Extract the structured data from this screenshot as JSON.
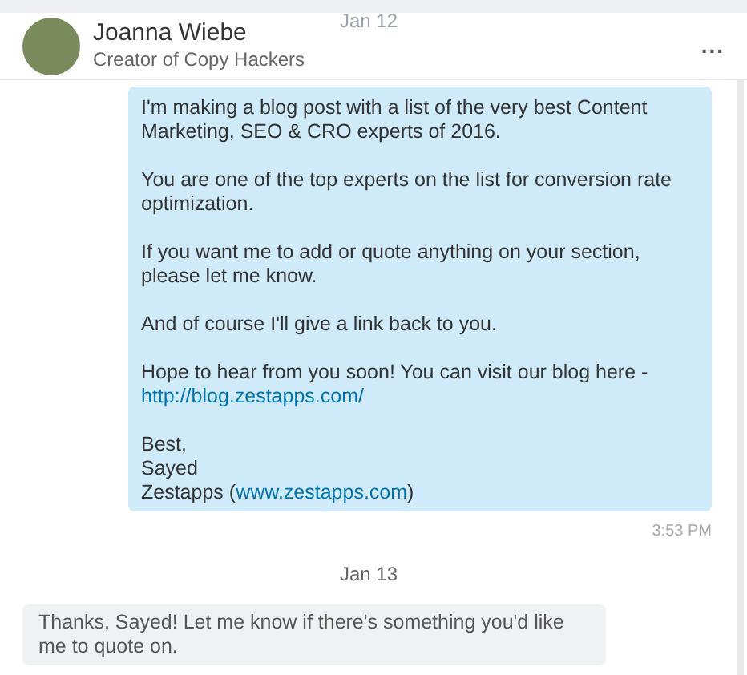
{
  "header": {
    "date_behind": "Jan 12",
    "name": "Joanna Wiebe",
    "subtitle": "Creator of Copy Hackers",
    "menu": "..."
  },
  "messages": [
    {
      "kind": "outgoing",
      "paragraphs": [
        [
          [
            {
              "kind": "text",
              "text": "I'm making a blog post with a list of the very best Content Marketing, SEO & CRO experts of 2016."
            }
          ]
        ],
        [
          [
            {
              "kind": "text",
              "text": "You are one of the top experts on the list for conversion rate optimization."
            }
          ]
        ],
        [
          [
            {
              "kind": "text",
              "text": "If you want me to add or quote anything on your section, please let me know."
            }
          ]
        ],
        [
          [
            {
              "kind": "text",
              "text": "And of course I'll give a link back to you."
            }
          ]
        ],
        [
          [
            {
              "kind": "text",
              "text": "Hope to hear from you soon! You can visit our blog here - "
            },
            {
              "kind": "link",
              "text": "http://blog.zestapps.com/"
            }
          ]
        ],
        [
          [
            {
              "kind": "text",
              "text": "Best,"
            }
          ],
          [
            {
              "kind": "text",
              "text": "Sayed"
            }
          ],
          [
            {
              "kind": "text",
              "text": "Zestapps ("
            },
            {
              "kind": "link",
              "text": "www.zestapps.com"
            },
            {
              "kind": "text",
              "text": ")"
            }
          ]
        ]
      ],
      "time": "3:53 PM"
    },
    {
      "kind": "date",
      "text": "Jan 13"
    },
    {
      "kind": "incoming",
      "paragraphs": [
        [
          [
            {
              "kind": "text",
              "text": "Thanks, Sayed! Let me know if there's something you'd like me to quote on."
            }
          ]
        ]
      ]
    }
  ]
}
